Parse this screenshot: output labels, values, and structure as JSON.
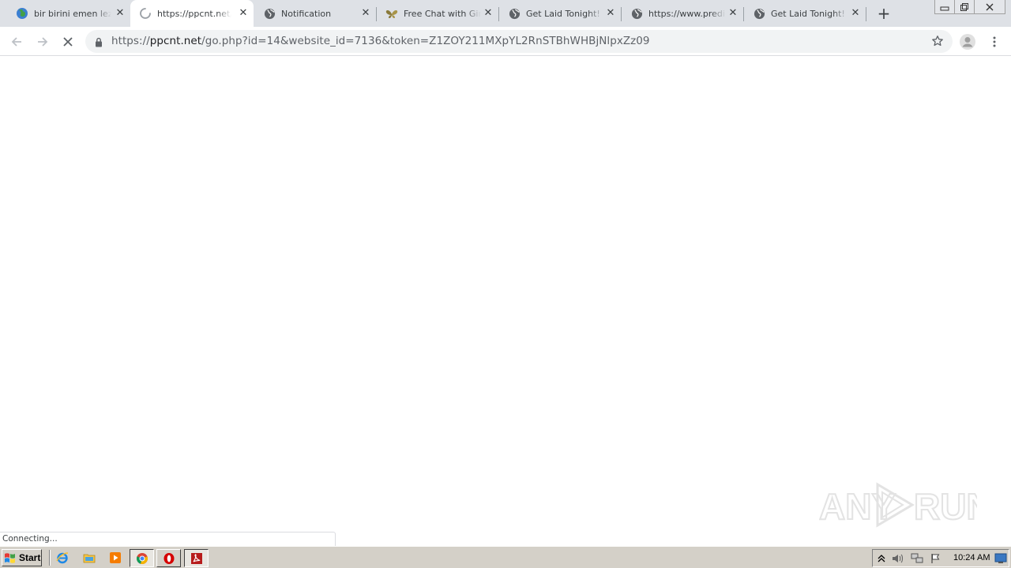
{
  "browser": {
    "tabs": [
      {
        "title": "bir birini emen lezbiyen",
        "icon": "globe-color-icon",
        "active": false
      },
      {
        "title": "https://ppcnt.net/go.php",
        "icon": "loading-spinner-icon",
        "active": true
      },
      {
        "title": "Notification",
        "icon": "globe-icon",
        "active": false
      },
      {
        "title": "Free Chat with Girls",
        "icon": "butterfly-icon",
        "active": false
      },
      {
        "title": "Get Laid Tonight!",
        "icon": "globe-icon",
        "active": false
      },
      {
        "title": "https://www.prediction",
        "icon": "globe-icon",
        "active": false
      },
      {
        "title": "Get Laid Tonight!",
        "icon": "globe-icon",
        "active": false
      }
    ],
    "new_tab_label": "+",
    "tab_close_glyph": "✕",
    "address": {
      "scheme": "https://",
      "host": "ppcnt.net",
      "path": "/go.php?id=14&website_id=7136&token=Z1ZOY211MXpYL2RnSTBhWHBjNlpxZz09"
    },
    "status_text": "Connecting..."
  },
  "watermark": {
    "text_left": "ANY",
    "text_right": "RUN"
  },
  "taskbar": {
    "start_label": "Start",
    "clock": "10:24 AM",
    "quick_launch": [
      "ie-icon",
      "folder-icon",
      "media-player-icon"
    ],
    "task_buttons": [
      "chrome-icon",
      "opera-icon",
      "acrobat-icon"
    ]
  },
  "colors": {
    "tabstrip": "#dee1e6",
    "omnibox": "#f1f3f4",
    "taskbar": "#d4d0c8",
    "watermark": "#e6e6e6"
  }
}
